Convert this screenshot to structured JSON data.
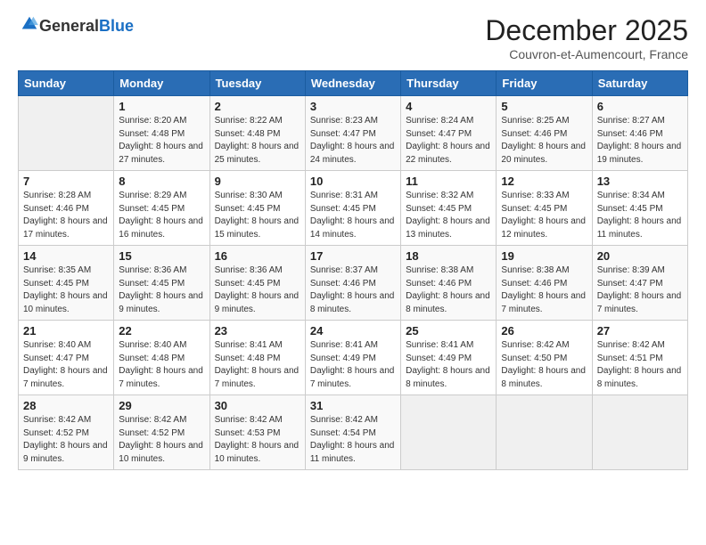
{
  "logo": {
    "general": "General",
    "blue": "Blue"
  },
  "header": {
    "month": "December 2025",
    "location": "Couvron-et-Aumencourt, France"
  },
  "weekdays": [
    "Sunday",
    "Monday",
    "Tuesday",
    "Wednesday",
    "Thursday",
    "Friday",
    "Saturday"
  ],
  "weeks": [
    [
      {
        "day": "",
        "info": ""
      },
      {
        "day": "1",
        "info": "Sunrise: 8:20 AM\nSunset: 4:48 PM\nDaylight: 8 hours\nand 27 minutes."
      },
      {
        "day": "2",
        "info": "Sunrise: 8:22 AM\nSunset: 4:48 PM\nDaylight: 8 hours\nand 25 minutes."
      },
      {
        "day": "3",
        "info": "Sunrise: 8:23 AM\nSunset: 4:47 PM\nDaylight: 8 hours\nand 24 minutes."
      },
      {
        "day": "4",
        "info": "Sunrise: 8:24 AM\nSunset: 4:47 PM\nDaylight: 8 hours\nand 22 minutes."
      },
      {
        "day": "5",
        "info": "Sunrise: 8:25 AM\nSunset: 4:46 PM\nDaylight: 8 hours\nand 20 minutes."
      },
      {
        "day": "6",
        "info": "Sunrise: 8:27 AM\nSunset: 4:46 PM\nDaylight: 8 hours\nand 19 minutes."
      }
    ],
    [
      {
        "day": "7",
        "info": "Sunrise: 8:28 AM\nSunset: 4:46 PM\nDaylight: 8 hours\nand 17 minutes."
      },
      {
        "day": "8",
        "info": "Sunrise: 8:29 AM\nSunset: 4:45 PM\nDaylight: 8 hours\nand 16 minutes."
      },
      {
        "day": "9",
        "info": "Sunrise: 8:30 AM\nSunset: 4:45 PM\nDaylight: 8 hours\nand 15 minutes."
      },
      {
        "day": "10",
        "info": "Sunrise: 8:31 AM\nSunset: 4:45 PM\nDaylight: 8 hours\nand 14 minutes."
      },
      {
        "day": "11",
        "info": "Sunrise: 8:32 AM\nSunset: 4:45 PM\nDaylight: 8 hours\nand 13 minutes."
      },
      {
        "day": "12",
        "info": "Sunrise: 8:33 AM\nSunset: 4:45 PM\nDaylight: 8 hours\nand 12 minutes."
      },
      {
        "day": "13",
        "info": "Sunrise: 8:34 AM\nSunset: 4:45 PM\nDaylight: 8 hours\nand 11 minutes."
      }
    ],
    [
      {
        "day": "14",
        "info": "Sunrise: 8:35 AM\nSunset: 4:45 PM\nDaylight: 8 hours\nand 10 minutes."
      },
      {
        "day": "15",
        "info": "Sunrise: 8:36 AM\nSunset: 4:45 PM\nDaylight: 8 hours\nand 9 minutes."
      },
      {
        "day": "16",
        "info": "Sunrise: 8:36 AM\nSunset: 4:45 PM\nDaylight: 8 hours\nand 9 minutes."
      },
      {
        "day": "17",
        "info": "Sunrise: 8:37 AM\nSunset: 4:46 PM\nDaylight: 8 hours\nand 8 minutes."
      },
      {
        "day": "18",
        "info": "Sunrise: 8:38 AM\nSunset: 4:46 PM\nDaylight: 8 hours\nand 8 minutes."
      },
      {
        "day": "19",
        "info": "Sunrise: 8:38 AM\nSunset: 4:46 PM\nDaylight: 8 hours\nand 7 minutes."
      },
      {
        "day": "20",
        "info": "Sunrise: 8:39 AM\nSunset: 4:47 PM\nDaylight: 8 hours\nand 7 minutes."
      }
    ],
    [
      {
        "day": "21",
        "info": "Sunrise: 8:40 AM\nSunset: 4:47 PM\nDaylight: 8 hours\nand 7 minutes."
      },
      {
        "day": "22",
        "info": "Sunrise: 8:40 AM\nSunset: 4:48 PM\nDaylight: 8 hours\nand 7 minutes."
      },
      {
        "day": "23",
        "info": "Sunrise: 8:41 AM\nSunset: 4:48 PM\nDaylight: 8 hours\nand 7 minutes."
      },
      {
        "day": "24",
        "info": "Sunrise: 8:41 AM\nSunset: 4:49 PM\nDaylight: 8 hours\nand 7 minutes."
      },
      {
        "day": "25",
        "info": "Sunrise: 8:41 AM\nSunset: 4:49 PM\nDaylight: 8 hours\nand 8 minutes."
      },
      {
        "day": "26",
        "info": "Sunrise: 8:42 AM\nSunset: 4:50 PM\nDaylight: 8 hours\nand 8 minutes."
      },
      {
        "day": "27",
        "info": "Sunrise: 8:42 AM\nSunset: 4:51 PM\nDaylight: 8 hours\nand 8 minutes."
      }
    ],
    [
      {
        "day": "28",
        "info": "Sunrise: 8:42 AM\nSunset: 4:52 PM\nDaylight: 8 hours\nand 9 minutes."
      },
      {
        "day": "29",
        "info": "Sunrise: 8:42 AM\nSunset: 4:52 PM\nDaylight: 8 hours\nand 10 minutes."
      },
      {
        "day": "30",
        "info": "Sunrise: 8:42 AM\nSunset: 4:53 PM\nDaylight: 8 hours\nand 10 minutes."
      },
      {
        "day": "31",
        "info": "Sunrise: 8:42 AM\nSunset: 4:54 PM\nDaylight: 8 hours\nand 11 minutes."
      },
      {
        "day": "",
        "info": ""
      },
      {
        "day": "",
        "info": ""
      },
      {
        "day": "",
        "info": ""
      }
    ]
  ]
}
